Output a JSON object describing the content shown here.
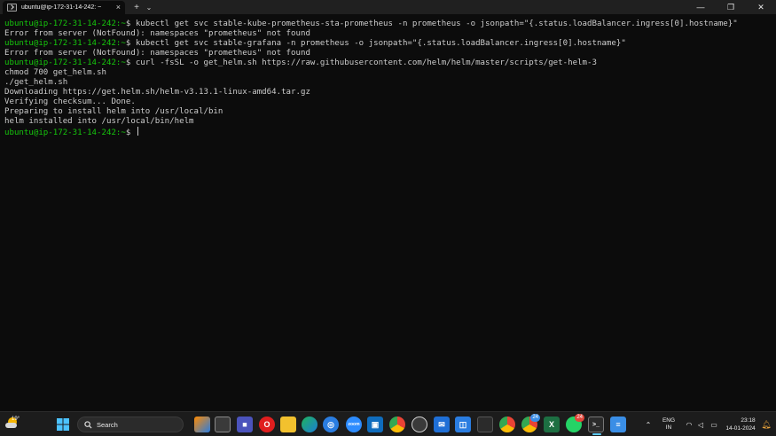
{
  "window": {
    "tab_title": "ubuntu@ip-172-31-14-242: ~",
    "tab_close": "×",
    "new_tab": "+",
    "dropdown": "⌄",
    "minimize": "—",
    "maximize": "❐",
    "close": "✕"
  },
  "terminal": {
    "prompt": "ubuntu@ip-172-31-14-242:~",
    "prompt_suffix": "$ ",
    "lines": [
      {
        "type": "cmd",
        "text": "kubectl get svc stable-kube-prometheus-sta-prometheus -n prometheus -o jsonpath=\"{.status.loadBalancer.ingress[0].hostname}\""
      },
      {
        "type": "out",
        "text": "Error from server (NotFound): namespaces \"prometheus\" not found"
      },
      {
        "type": "cmd",
        "text": "kubectl get svc stable-grafana -n prometheus -o jsonpath=\"{.status.loadBalancer.ingress[0].hostname}\""
      },
      {
        "type": "out",
        "text": "Error from server (NotFound): namespaces \"prometheus\" not found"
      },
      {
        "type": "cmd",
        "text": "curl -fsSL -o get_helm.sh https://raw.githubusercontent.com/helm/helm/master/scripts/get-helm-3"
      },
      {
        "type": "out",
        "text": "chmod 700 get_helm.sh"
      },
      {
        "type": "out",
        "text": "./get_helm.sh"
      },
      {
        "type": "out",
        "text": "Downloading https://get.helm.sh/helm-v3.13.1-linux-amd64.tar.gz"
      },
      {
        "type": "out",
        "text": "Verifying checksum... Done."
      },
      {
        "type": "out",
        "text": "Preparing to install helm into /usr/local/bin"
      },
      {
        "type": "out",
        "text": "helm installed into /usr/local/bin/helm"
      },
      {
        "type": "cmd",
        "text": ""
      }
    ]
  },
  "taskbar": {
    "weather_temp": "19°",
    "search_label": "Search",
    "badges": {
      "whatsapp": "24",
      "chrome_profile": "24"
    },
    "lang_line1": "ENG",
    "lang_line2": "IN",
    "time": "23:18",
    "date": "14-01-2024",
    "colors": {
      "prompt_green": "#16c60c",
      "terminal_bg": "#0c0c0c",
      "taskbar_bg": "#1c1c1c",
      "accent": "#60cdff"
    }
  }
}
